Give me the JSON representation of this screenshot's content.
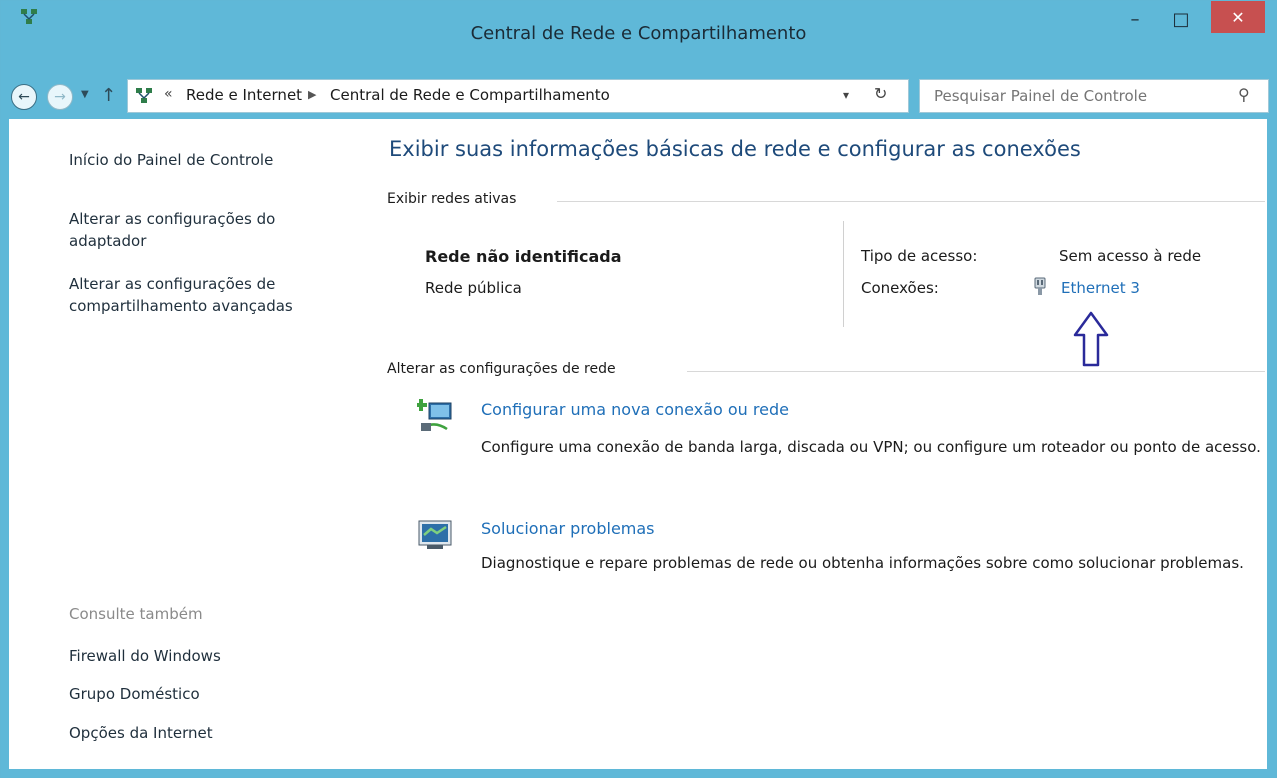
{
  "window": {
    "title": "Central de Rede e Compartilhamento",
    "controls": {
      "minimize": "–",
      "maximize": "□",
      "close": "✕"
    }
  },
  "address_bar": {
    "chevron": "«",
    "breadcrumbs": [
      "Rede e Internet",
      "Central de Rede e Compartilhamento"
    ],
    "search_placeholder": "Pesquisar Painel de Controle"
  },
  "sidebar": {
    "home": "Início do Painel de Controle",
    "adapter_settings": "Alterar as configurações do adaptador",
    "sharing_settings": "Alterar as configurações de compartilhamento avançadas",
    "see_also_title": "Consulte também",
    "see_also": [
      "Firewall do Windows",
      "Grupo Doméstico",
      "Opções da Internet"
    ]
  },
  "main": {
    "title": "Exibir suas informações básicas de rede e configurar as conexões",
    "active_networks_label": "Exibir redes ativas",
    "network": {
      "name": "Rede não identificada",
      "type": "Rede pública",
      "access_type_label": "Tipo de acesso:",
      "access_type_value": "Sem acesso à rede",
      "connections_label": "Conexões:",
      "connection_name": "Ethernet 3"
    },
    "change_settings_label": "Alterar as configurações de rede",
    "tasks": [
      {
        "title": "Configurar uma nova conexão ou rede",
        "description": "Configure uma conexão de banda larga, discada ou VPN; ou configure um roteador ou ponto de acesso."
      },
      {
        "title": "Solucionar problemas",
        "description": "Diagnostique e repare problemas de rede ou obtenha informações sobre como solucionar problemas."
      }
    ]
  },
  "colors": {
    "chrome": "#5fb8d8",
    "link": "#1f6fb8",
    "title": "#1e4a7a",
    "close_button": "#c75050",
    "annotation_arrow": "#2a2a9a"
  },
  "icons": [
    "network-center-icon",
    "back-icon",
    "forward-icon",
    "recent-pages-icon",
    "up-icon",
    "refresh-icon",
    "search-icon",
    "ethernet-icon",
    "new-connection-icon",
    "troubleshoot-icon",
    "annotation-arrow"
  ]
}
